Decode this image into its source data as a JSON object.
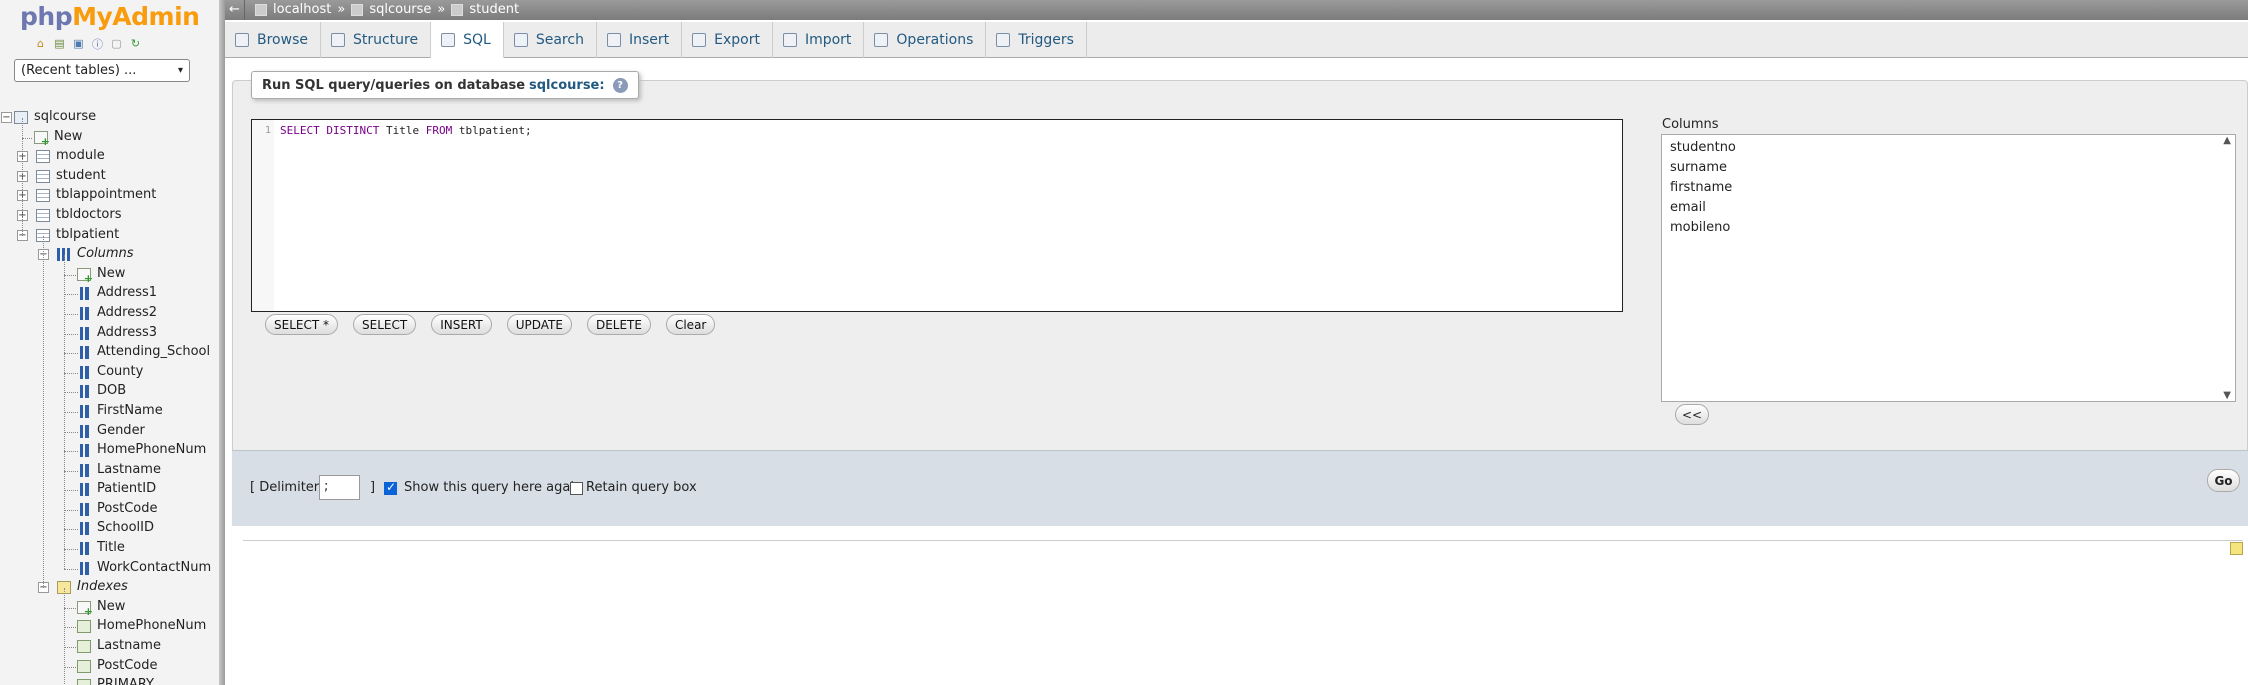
{
  "sidebar": {
    "logo": {
      "php": "php",
      "my": "My",
      "admin": "Admin"
    },
    "nav_icons": [
      "home-icon",
      "database-icon",
      "sql-icon",
      "info-icon",
      "docs-icon",
      "reload-icon"
    ],
    "recent_select": "(Recent tables) ...",
    "tree": {
      "database": "sqlcourse",
      "db_new": "New",
      "tables": [
        "module",
        "student",
        "tblappointment",
        "tbldoctors"
      ],
      "open_table": "tblpatient",
      "columns_group": "Columns",
      "columns_new": "New",
      "columns": [
        "Address1",
        "Address2",
        "Address3",
        "Attending_School",
        "County",
        "DOB",
        "FirstName",
        "Gender",
        "HomePhoneNum",
        "Lastname",
        "PatientID",
        "PostCode",
        "SchoolID",
        "Title",
        "WorkContactNum"
      ],
      "indexes_group": "Indexes",
      "indexes_new": "New",
      "indexes": [
        "HomePhoneNum",
        "Lastname",
        "PostCode",
        "PRIMARY"
      ]
    }
  },
  "topbar": {
    "back": "←",
    "breadcrumb": {
      "server": "localhost",
      "sep": "»",
      "database": "sqlcourse",
      "table": "student"
    }
  },
  "tabs": [
    {
      "label": "Browse",
      "icon": "browse-icon",
      "active": false
    },
    {
      "label": "Structure",
      "icon": "structure-icon",
      "active": false
    },
    {
      "label": "SQL",
      "icon": "sql-icon",
      "active": true
    },
    {
      "label": "Search",
      "icon": "search-icon",
      "active": false
    },
    {
      "label": "Insert",
      "icon": "insert-icon",
      "active": false
    },
    {
      "label": "Export",
      "icon": "export-icon",
      "active": false
    },
    {
      "label": "Import",
      "icon": "import-icon",
      "active": false
    },
    {
      "label": "Operations",
      "icon": "wrench-icon",
      "active": false
    },
    {
      "label": "Triggers",
      "icon": "triggers-icon",
      "active": false
    }
  ],
  "sql": {
    "legend_text": "Run SQL query/queries on database",
    "legend_db": "sqlcourse:",
    "line_number": "1",
    "code": {
      "kw1": "SELECT DISTINCT",
      "ident": " Title ",
      "kw2": "FROM",
      "rest": " tblpatient;"
    },
    "buttons": [
      "SELECT *",
      "SELECT",
      "INSERT",
      "UPDATE",
      "DELETE",
      "Clear"
    ],
    "columns_label": "Columns",
    "columns": [
      "studentno",
      "surname",
      "firstname",
      "email",
      "mobileno"
    ],
    "insert_button": "<<"
  },
  "options": {
    "delimiter_label": "[ Delimiter",
    "delimiter_value": ";",
    "delimiter_close": "]",
    "show_again_label": "Show this query here again",
    "show_again_checked": true,
    "retain_label": "Retain query box",
    "retain_checked": false,
    "go_label": "Go"
  },
  "colors": {
    "link": "#235a81",
    "keyword": "#770088",
    "accent_checkbox": "#0a63d8"
  }
}
